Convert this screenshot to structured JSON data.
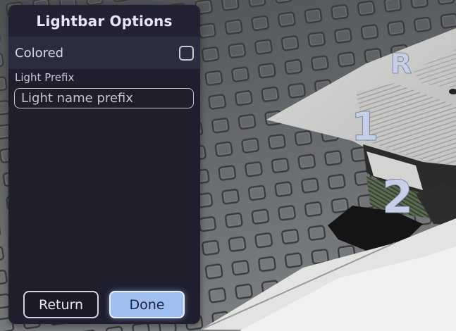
{
  "panel": {
    "title": "Lightbar Options",
    "colored_label": "Colored",
    "colored_checked": false,
    "prefix_label": "Light Prefix",
    "prefix_placeholder": "Light name prefix",
    "prefix_value": "",
    "return_label": "Return",
    "done_label": "Done"
  },
  "viewport": {
    "markers": [
      "R",
      "1",
      "2"
    ]
  },
  "colors": {
    "panel_bg": "#1e1e2d",
    "row_bg": "#2b2c3e",
    "done_accent": "#9ebff0",
    "marker_color": "#c5cfe8"
  }
}
